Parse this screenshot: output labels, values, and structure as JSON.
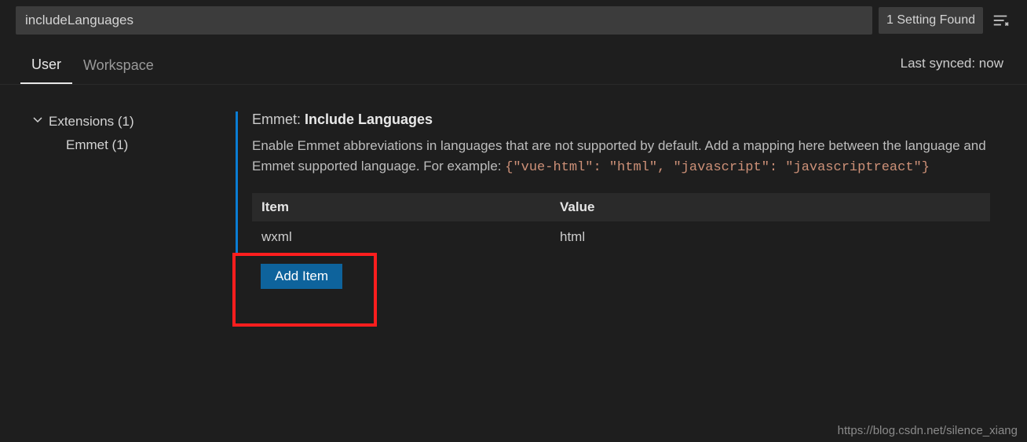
{
  "search": {
    "value": "includeLanguages"
  },
  "found_badge": "1 Setting Found",
  "tabs": {
    "user": "User",
    "workspace": "Workspace"
  },
  "sync_status": "Last synced: now",
  "sidebar": {
    "extensions_label": "Extensions (1)",
    "emmet_label": "Emmet (1)"
  },
  "setting": {
    "prefix": "Emmet: ",
    "name": "Include Languages",
    "desc_before": "Enable Emmet abbreviations in languages that are not supported by default. Add a mapping here between the language and Emmet supported language. For example: ",
    "desc_code": "{\"vue-html\": \"html\", \"javascript\": \"javascriptreact\"}"
  },
  "table": {
    "head_item": "Item",
    "head_value": "Value",
    "rows": [
      {
        "item": "wxml",
        "value": "html"
      }
    ]
  },
  "add_button": "Add Item",
  "watermark": "https://blog.csdn.net/silence_xiang"
}
